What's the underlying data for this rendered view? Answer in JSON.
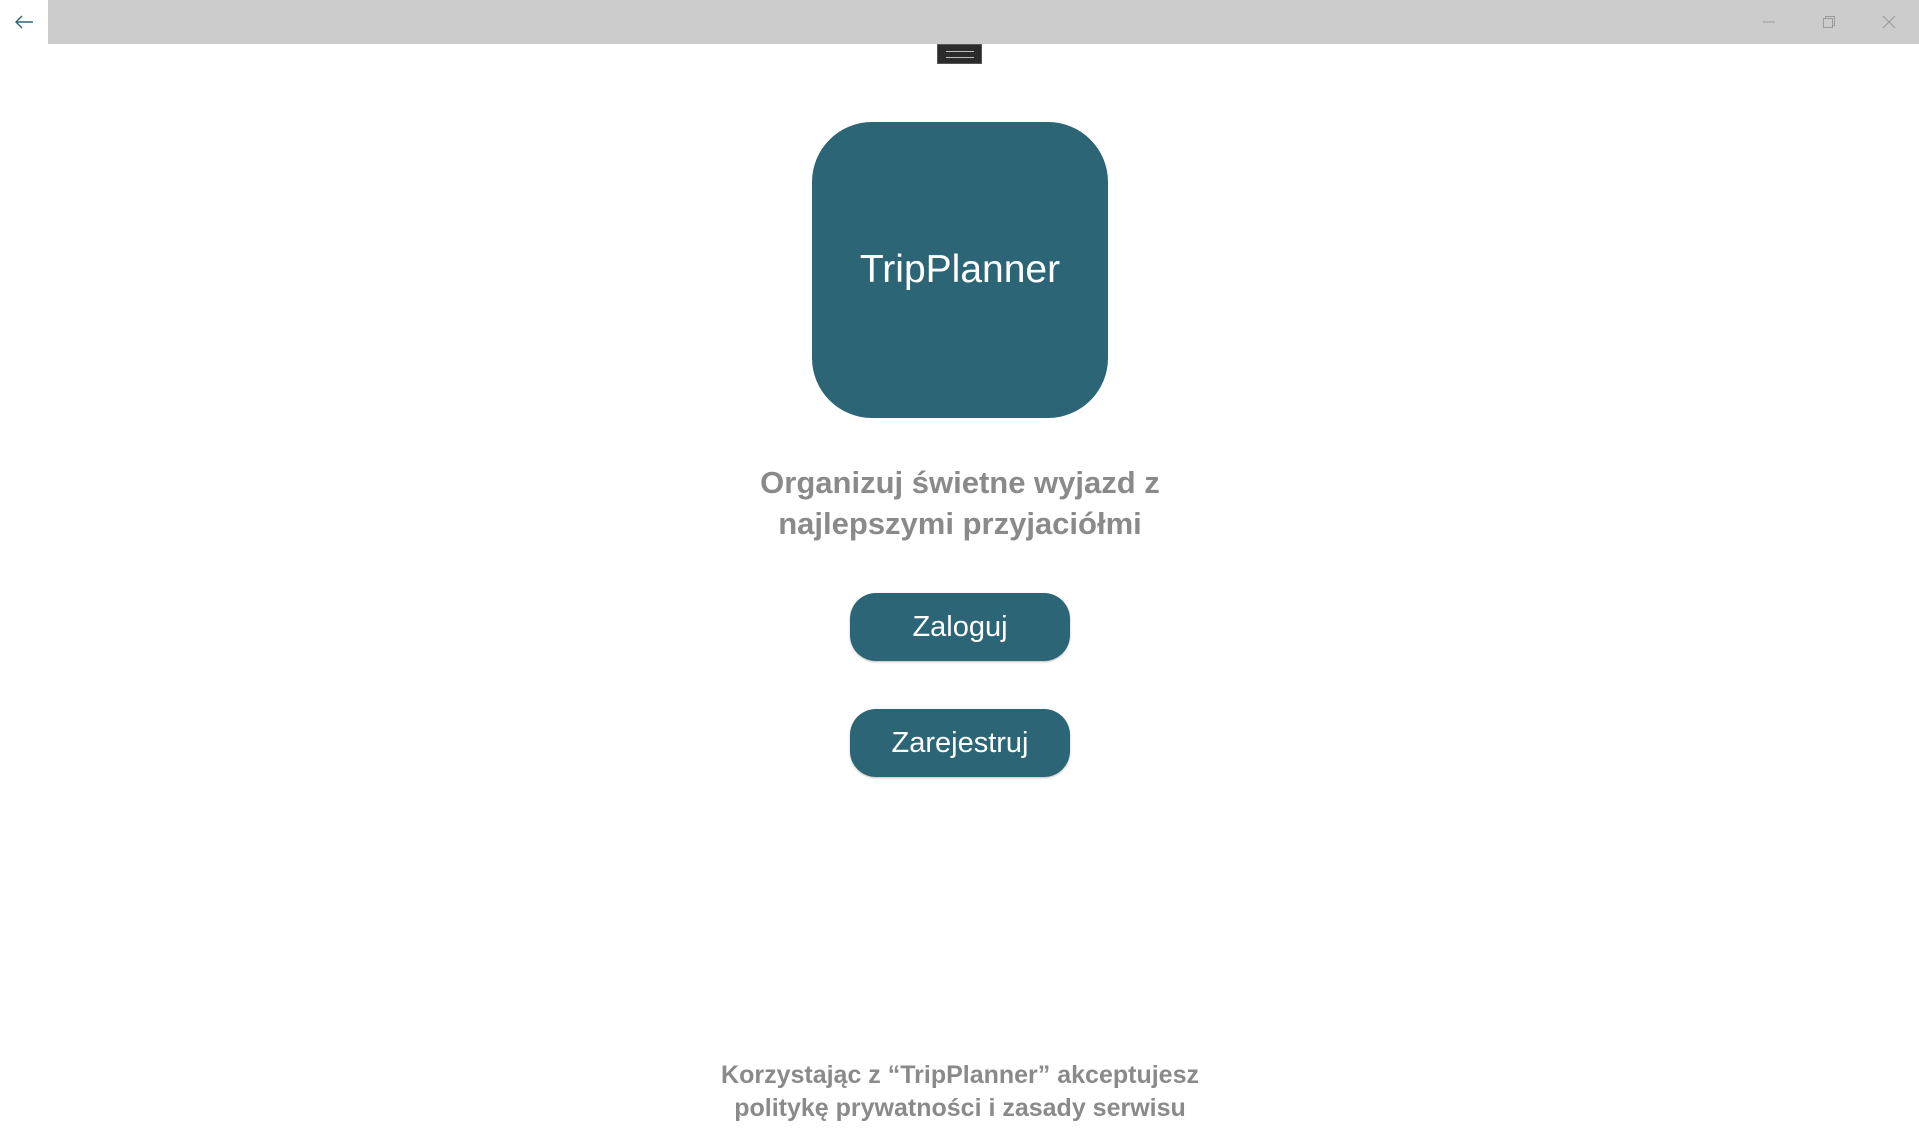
{
  "window": {
    "back_icon": "back-arrow-icon",
    "minimize_icon": "minimize-icon",
    "maximize_icon": "restore-icon",
    "close_icon": "close-icon"
  },
  "app": {
    "logo_text": "TripPlanner",
    "accent_color": "#2c6576"
  },
  "welcome": {
    "tagline_line1": "Organizuj świetne wyjazd z",
    "tagline_line2": "najlepszymi przyjaciółmi"
  },
  "actions": {
    "login_label": "Zaloguj",
    "register_label": "Zarejestruj"
  },
  "footer": {
    "line1": "Korzystając z “TripPlanner” akceptujesz",
    "line2": "politykę prywatności i zasady serwisu"
  }
}
